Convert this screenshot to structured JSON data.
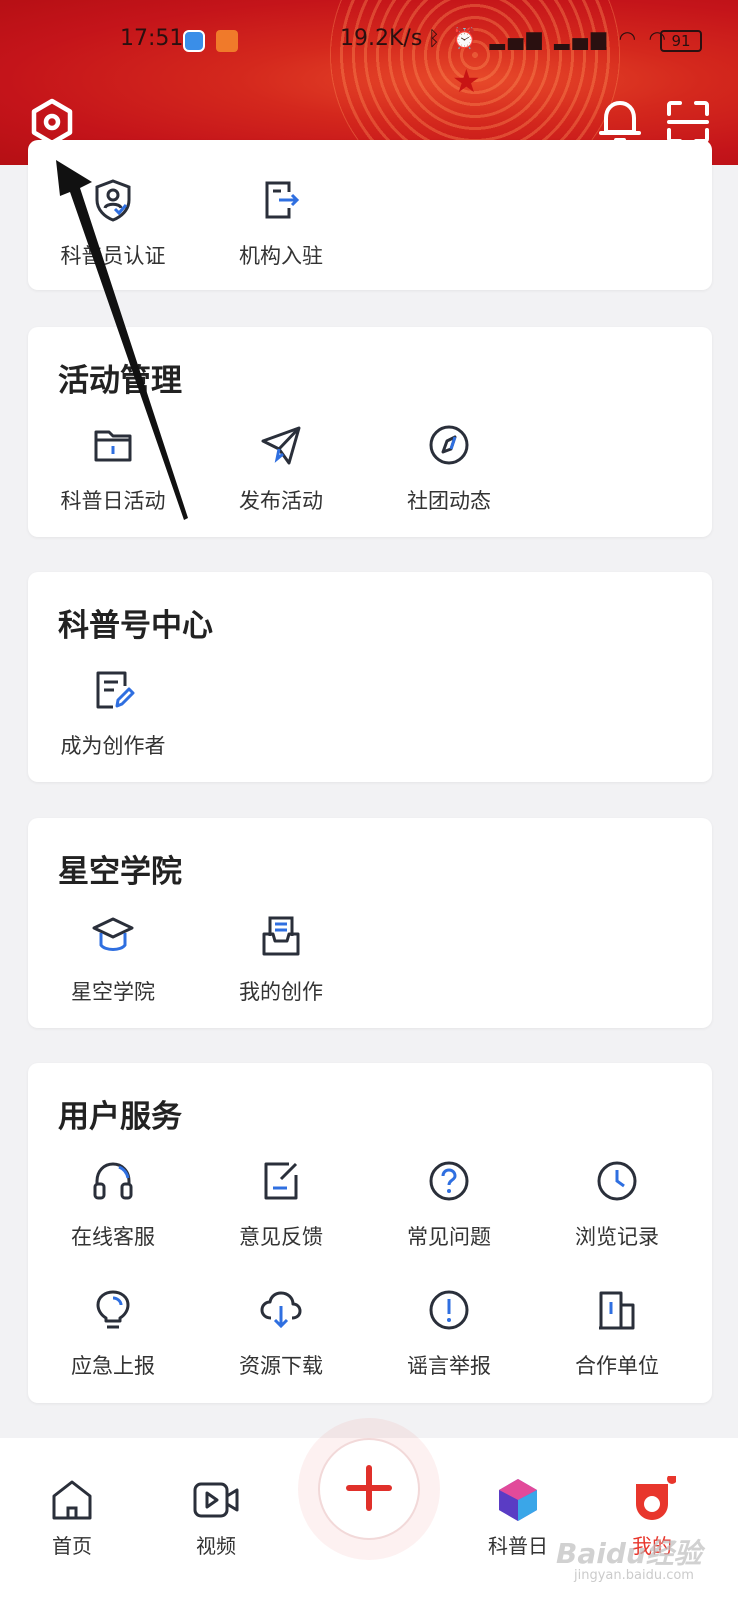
{
  "status_bar": {
    "time": "17:51",
    "network_speed": "19.2K/s",
    "battery": "91",
    "icons": [
      "bluetooth-icon",
      "alarm-icon",
      "signal-hd-icon",
      "signal-hd-icon",
      "wifi-icon",
      "wifi-icon"
    ]
  },
  "header": {
    "icons": [
      "settings-icon",
      "bell-icon",
      "scan-icon"
    ]
  },
  "card_verify": {
    "items": [
      {
        "label": "科普员认证",
        "icon": "shield-user-icon"
      },
      {
        "label": "机构入驻",
        "icon": "enter-doc-icon"
      }
    ]
  },
  "card_activity": {
    "title": "活动管理",
    "items": [
      {
        "label": "科普日活动",
        "icon": "folder-icon"
      },
      {
        "label": "发布活动",
        "icon": "paper-plane-icon"
      },
      {
        "label": "社团动态",
        "icon": "compass-icon"
      }
    ]
  },
  "card_kepu": {
    "title": "科普号中心",
    "items": [
      {
        "label": "成为创作者",
        "icon": "edit-doc-icon"
      }
    ]
  },
  "card_academy": {
    "title": "星空学院",
    "items": [
      {
        "label": "星空学院",
        "icon": "graduation-cap-icon"
      },
      {
        "label": "我的创作",
        "icon": "inbox-doc-icon"
      }
    ]
  },
  "card_service": {
    "title": "用户服务",
    "items": [
      {
        "label": "在线客服",
        "icon": "headset-icon"
      },
      {
        "label": "意见反馈",
        "icon": "feedback-icon"
      },
      {
        "label": "常见问题",
        "icon": "question-icon"
      },
      {
        "label": "浏览记录",
        "icon": "clock-icon"
      },
      {
        "label": "应急上报",
        "icon": "bulb-icon"
      },
      {
        "label": "资源下载",
        "icon": "cloud-download-icon"
      },
      {
        "label": "谣言举报",
        "icon": "exclamation-icon"
      },
      {
        "label": "合作单位",
        "icon": "building-icon"
      }
    ]
  },
  "bottom_nav": {
    "items": [
      {
        "label": "首页",
        "icon": "home-icon"
      },
      {
        "label": "视频",
        "icon": "video-icon"
      },
      {
        "label": "",
        "icon": "plus-icon"
      },
      {
        "label": "科普日",
        "icon": "cube-icon"
      },
      {
        "label": "我的",
        "icon": "profile-icon"
      }
    ]
  },
  "watermark": {
    "text": "Baidu经验",
    "sub": "jingyan.baidu.com"
  },
  "colors": {
    "header_red": "#c4141a",
    "accent_blue": "#2f6fe0",
    "icon_dark": "#2a2f3a",
    "plus_red": "#e0302a"
  }
}
